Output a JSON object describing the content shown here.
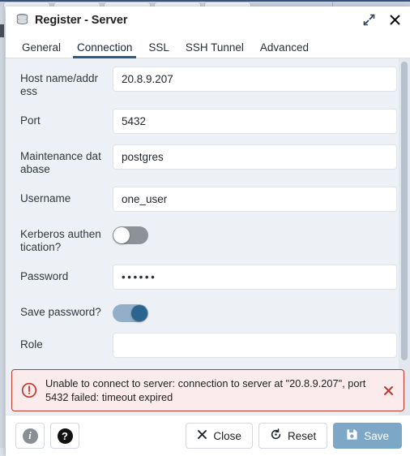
{
  "background": {
    "tab_count": 5
  },
  "dialog": {
    "title": "Register - Server",
    "title_icon": "server-icon",
    "maximize_icon": "expand-diagonal-icon",
    "close_icon": "close-icon"
  },
  "tabs": [
    {
      "label": "General",
      "active": false
    },
    {
      "label": "Connection",
      "active": true
    },
    {
      "label": "SSL",
      "active": false
    },
    {
      "label": "SSH Tunnel",
      "active": false
    },
    {
      "label": "Advanced",
      "active": false
    }
  ],
  "form": {
    "fields": [
      {
        "label": "Host name/address",
        "type": "text",
        "value": "20.8.9.207",
        "placeholder": ""
      },
      {
        "label": "Port",
        "type": "text",
        "value": "5432",
        "placeholder": ""
      },
      {
        "label": "Maintenance database",
        "type": "text",
        "value": "postgres",
        "placeholder": ""
      },
      {
        "label": "Username",
        "type": "text",
        "value": "one_user",
        "placeholder": ""
      },
      {
        "label": "Kerberos authentication?",
        "type": "toggle",
        "value": "off"
      },
      {
        "label": "Password",
        "type": "password",
        "value": "••••••",
        "placeholder": ""
      },
      {
        "label": "Save password?",
        "type": "toggle",
        "value": "on"
      },
      {
        "label": "Role",
        "type": "text",
        "value": "",
        "placeholder": ""
      }
    ]
  },
  "alert": {
    "icon": "error-circle-icon",
    "message": "Unable to connect to server: connection to server at \"20.8.9.207\", port 5432 failed: timeout expired",
    "close_icon": "close-icon",
    "border_color": "#c0392b",
    "background_color": "#fcebec"
  },
  "footer": {
    "info_label": "i",
    "help_label": "?",
    "close_label": "Close",
    "reset_label": "Reset",
    "save_label": "Save",
    "save_color": "#7da7c6"
  }
}
